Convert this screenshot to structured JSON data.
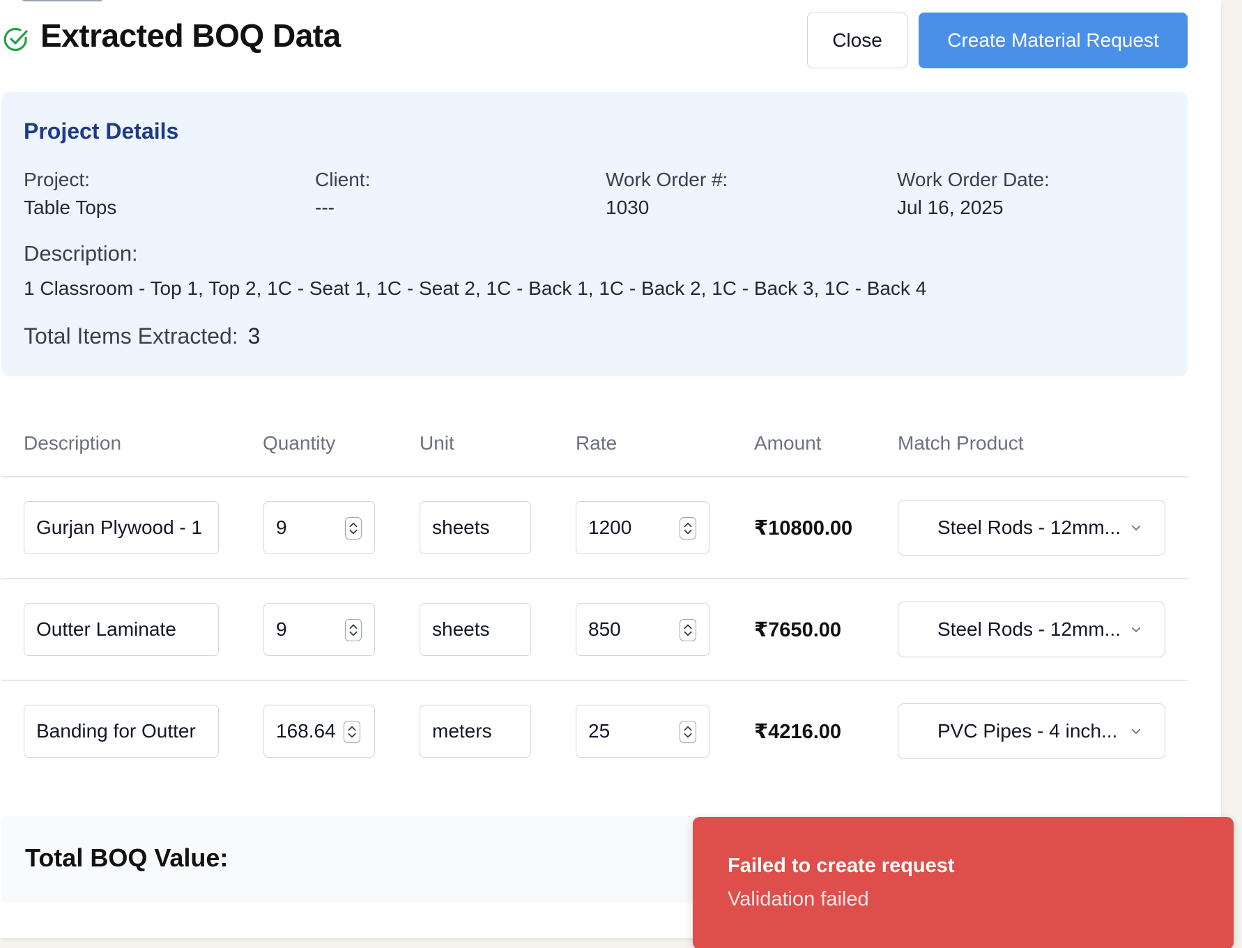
{
  "header": {
    "title": "Extracted BOQ Data",
    "close_label": "Close",
    "create_label": "Create Material Request",
    "primary_color": "#4a90e8"
  },
  "project": {
    "section_title": "Project Details",
    "project_label": "Project:",
    "project_value": "Table Tops",
    "client_label": "Client:",
    "client_value": "---",
    "work_order_label": "Work Order #:",
    "work_order_value": "1030",
    "work_order_date_label": "Work Order Date:",
    "work_order_date_value": "Jul 16, 2025",
    "description_label": "Description:",
    "description_value": "1 Classroom - Top 1, Top 2, 1C - Seat 1, 1C - Seat 2, 1C - Back 1, 1C - Back 2, 1C - Back 3, 1C - Back 4",
    "total_items_label": "Total Items Extracted:",
    "total_items_value": "3"
  },
  "table": {
    "columns": [
      "Description",
      "Quantity",
      "Unit",
      "Rate",
      "Amount",
      "Match Product"
    ],
    "rows": [
      {
        "description": "Gurjan Plywood - 1",
        "quantity": "9",
        "unit": "sheets",
        "rate": "1200",
        "amount": "₹10800.00",
        "product": "Steel Rods - 12mm..."
      },
      {
        "description": "Outter Laminate",
        "quantity": "9",
        "unit": "sheets",
        "rate": "850",
        "amount": "₹7650.00",
        "product": "Steel Rods - 12mm..."
      },
      {
        "description": "Banding for Outter",
        "quantity": "168.64",
        "unit": "meters",
        "rate": "25",
        "amount": "₹4216.00",
        "product": "PVC Pipes - 4 inch..."
      }
    ]
  },
  "total": {
    "label": "Total BOQ Value:"
  },
  "toast": {
    "title": "Failed to create request",
    "message": "Validation failed",
    "color": "#de4e4b"
  }
}
